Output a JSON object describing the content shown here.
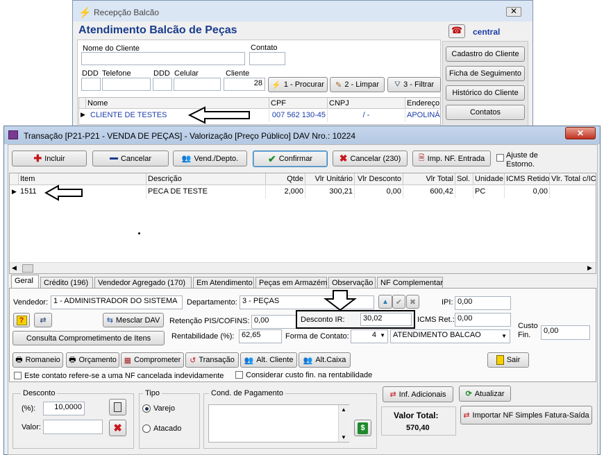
{
  "bg_window": {
    "title": "Recepção Balcão",
    "heading": "Atendimento Balcão de Peças",
    "user": "central",
    "labels": {
      "nome": "Nome do Cliente",
      "contato": "Contato",
      "ddd1": "DDD",
      "telefone": "Telefone",
      "ddd2": "DDD",
      "celular": "Celular",
      "cliente": "Cliente"
    },
    "cliente_value": "28",
    "buttons": {
      "procurar": "1 - Procurar",
      "limpar": "2 - Limpar",
      "filtrar": "3 - Filtrar"
    },
    "grid_headers": [
      "Nome",
      "CPF",
      "CNPJ",
      "Endereço"
    ],
    "grid_row": [
      "CLIENTE DE TESTES",
      "007 562 130-45",
      "/    -",
      "APOLINÁ"
    ],
    "side_buttons": [
      "Cadastro do Cliente",
      "Ficha de Seguimento",
      "Histórico do Cliente",
      "Contatos"
    ]
  },
  "window": {
    "title": "Transação [P21-P21 - VENDA DE PEÇAS] - Valorização [Preço Público]  DAV Nro.: 10224",
    "close": "x"
  },
  "toolbar": {
    "incluir": "Incluir",
    "cancelar": "Cancelar",
    "vend_depto": "Vend./Depto.",
    "confirmar": "Confirmar",
    "cancelar_230": "Cancelar (230)",
    "imp_nf": "Imp. NF. Entrada",
    "ajuste_line1": "Ajuste  de",
    "ajuste_line2": "Estorno."
  },
  "items_grid": {
    "headers": [
      "Item",
      "Descrição",
      "Qtde",
      "Vlr Unitário",
      "Vlr Desconto",
      "Vlr Total",
      "Sol.",
      "Unidade",
      "ICMS Retido",
      "Vlr. Total c/IC"
    ],
    "rows": [
      [
        "1511",
        "PECA DE TESTE",
        "2,000",
        "300,21",
        "0,00",
        "600,42",
        "",
        "PC",
        "0,00",
        ""
      ]
    ]
  },
  "tabs": [
    "Geral",
    "Crédito (196)",
    "Vendedor Agregado (170)",
    "Em Atendimento",
    "Peças em Armazém",
    "Observação",
    "NF Complementar"
  ],
  "form": {
    "vendedor_label": "Vendedor:",
    "vendedor_value": "1 - ADMINISTRADOR DO SISTEMA",
    "departamento_label": "Departamento:",
    "departamento_value": "3 - PEÇAS",
    "ipi_label": "IPI:",
    "ipi_value": "0,00",
    "mesclar": "Mesclar DAV",
    "retencao_label": "Retenção PIS/COFINS:",
    "retencao_value": "0,00",
    "desconto_ir_label": "Desconto IR:",
    "desconto_ir_value": "30,02",
    "icms_label": "ICMS Ret.:",
    "icms_value": "0,00",
    "custo_label_1": "Custo",
    "custo_label_2": "Fin.",
    "custo_value": "0,00",
    "consulta": "Consulta Comprometimento de Itens",
    "rentabilidade_label": "Rentabilidade (%):",
    "rentabilidade_value": "62,65",
    "forma_label": "Forma de Contato:",
    "forma_num": "4",
    "forma_value": "ATENDIMENTO BALCAO"
  },
  "action_buttons": [
    "Romaneio",
    "Orçamento",
    "Comprometer",
    "Transação",
    "Alt. Cliente",
    "Alt.Caixa"
  ],
  "sair": "Sair",
  "checks": {
    "cancelada": "Este contato refere-se a uma NF cancelada indevidamente",
    "custo": "Considerar custo fin. na rentabilidade"
  },
  "desconto": {
    "legend": "Desconto",
    "pct_label": "(%):",
    "pct_value": "10,0000",
    "valor_label": "Valor:"
  },
  "tipo": {
    "legend": "Tipo",
    "options": [
      "Varejo",
      "Atacado"
    ],
    "selected": "Varejo"
  },
  "cond_pagamento": "Cond. de Pagamento",
  "inf_adicionais": "Inf. Adicionais",
  "atualizar": "Atualizar",
  "valor_total_label": "Valor Total:",
  "valor_total_value": "570,40",
  "importar": "Importar NF Simples Fatura-Saída",
  "colors": {
    "title_blue": "#1a3c8c",
    "link_blue": "#1a3ca8",
    "red": "#c8161d",
    "green": "#1f8a2b"
  }
}
